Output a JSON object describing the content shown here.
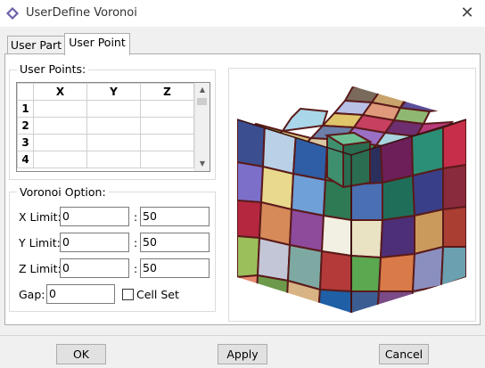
{
  "window": {
    "title": "UserDefine Voronoi",
    "icon": "voronoi-app-icon"
  },
  "tabs": [
    {
      "label": "User Part",
      "active": false
    },
    {
      "label": "User Point",
      "active": true
    }
  ],
  "user_points": {
    "group_label": "User Points:",
    "columns": [
      "X",
      "Y",
      "Z"
    ],
    "rows": [
      {
        "index": "1",
        "x": "",
        "y": "",
        "z": ""
      },
      {
        "index": "2",
        "x": "",
        "y": "",
        "z": ""
      },
      {
        "index": "3",
        "x": "",
        "y": "",
        "z": ""
      },
      {
        "index": "4",
        "x": "",
        "y": "",
        "z": ""
      }
    ]
  },
  "voronoi_option": {
    "group_label": "Voronoi Option:",
    "x_limit": {
      "label": "X Limit:",
      "min": "0",
      "max": "50"
    },
    "y_limit": {
      "label": "Y Limit:",
      "min": "0",
      "max": "50"
    },
    "z_limit": {
      "label": "Z Limit:",
      "min": "0",
      "max": "50"
    },
    "separator": ":",
    "gap": {
      "label": "Gap:",
      "value": "0"
    },
    "cell_set": {
      "label": "Cell Set",
      "checked": false
    }
  },
  "buttons": {
    "ok": "OK",
    "apply": "Apply",
    "cancel": "Cancel"
  }
}
